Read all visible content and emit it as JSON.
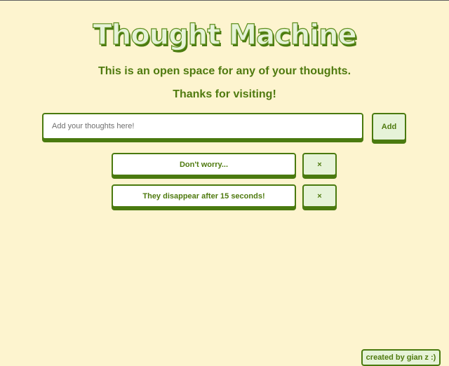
{
  "header": {
    "title": "Thought Machine",
    "subtitle": "This is an open space for any of your thoughts.",
    "thanks": "Thanks for visiting!"
  },
  "composer": {
    "placeholder": "Add your thoughts here!",
    "value": "",
    "add_label": "Add"
  },
  "thoughts": [
    {
      "text": "Don't worry...",
      "remove_label": "×"
    },
    {
      "text": "They disappear after 15 seconds!",
      "remove_label": "×"
    }
  ],
  "footer": {
    "credit": "created by gian z :)"
  },
  "colors": {
    "background": "#fdf4cf",
    "accent": "#4a7a0f",
    "text": "#4f7a0f",
    "button_fill": "#e6f3d8"
  }
}
